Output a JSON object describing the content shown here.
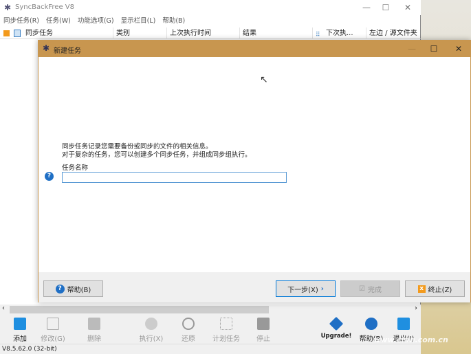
{
  "main": {
    "title": "SyncBackFree V8",
    "menu": [
      "同步任务(R)",
      "任务(W)",
      "功能选项(G)",
      "显示栏目(L)",
      "帮助(B)"
    ],
    "columns": [
      "同步任务",
      "类别",
      "上次执行时间",
      "结果",
      "下次执...",
      "左边 / 源文件夹"
    ]
  },
  "dialog": {
    "title": "新建任务",
    "info_line1": "同步任务记录您需要备份或同步的文件的相关信息。",
    "info_line2": "对于复杂的任务，您可以创建多个同步任务，并组成同步组执行。",
    "name_label": "任务名称",
    "name_value": "",
    "help_button": "帮助(B)",
    "next_button": "下一步(X)",
    "finish_button": "完成",
    "cancel_button": "终止(Z)"
  },
  "toolbar": [
    "添加",
    "修改(G)",
    "删除",
    "执行(X)",
    "还原",
    "计划任务",
    "停止",
    "Upgrade!",
    "帮助(B)",
    "退出(I)"
  ],
  "status": {
    "version": "V8.5.62.0 (32-bit)"
  },
  "watermark": "www.cfan.com.cn",
  "colors": {
    "dialog_title": "#c8964f",
    "accent": "#1f6fc5"
  }
}
